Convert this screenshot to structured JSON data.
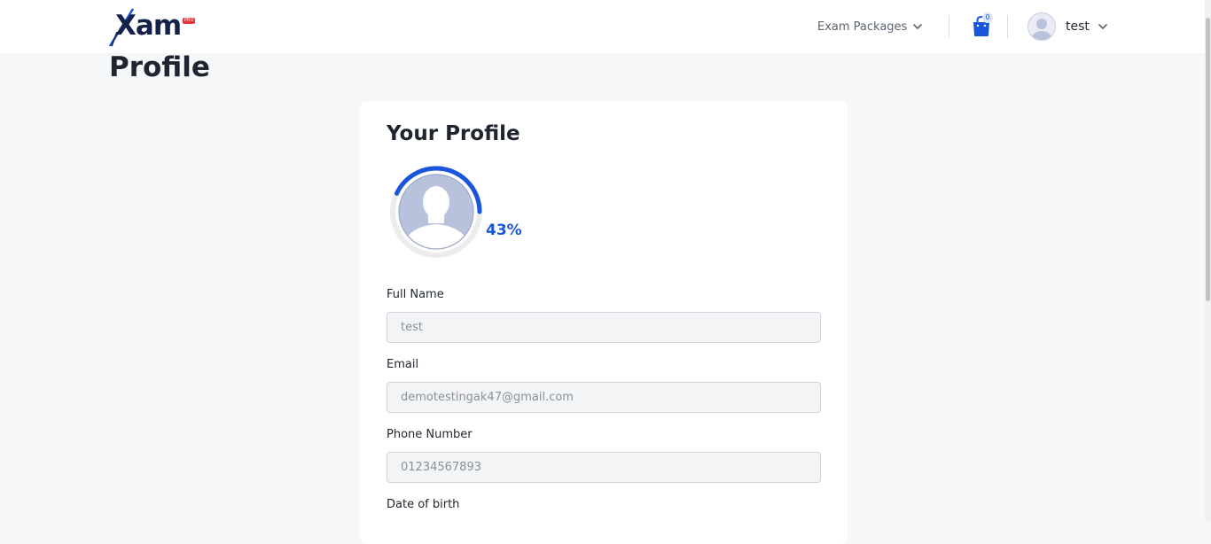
{
  "header": {
    "logo_text": "Xam",
    "logo_badge": "PRO",
    "exam_packages_label": "Exam Packages",
    "cart_count": "0",
    "user_name": "test"
  },
  "page": {
    "title": "Profile"
  },
  "profile_card": {
    "title": "Your Profile",
    "completion_percent": 43,
    "completion_label": "43%",
    "fields": {
      "full_name": {
        "label": "Full Name",
        "value": "test"
      },
      "email": {
        "label": "Email",
        "value": "demotestingak47@gmail.com"
      },
      "phone": {
        "label": "Phone Number",
        "value": "01234567893"
      },
      "dob": {
        "label": "Date of birth"
      }
    }
  },
  "colors": {
    "accent": "#1a56db",
    "logo_navy": "#14224a",
    "badge_red": "#e0353d",
    "page_bg": "#f6f7f9",
    "input_bg": "#f3f4f6"
  },
  "icons": {
    "logo": "xam-logo",
    "exam_packages_chevron": "chevron-down-icon",
    "cart": "shopping-bag-icon",
    "user_avatar": "user-placeholder-icon",
    "user_chevron": "chevron-down-icon"
  }
}
